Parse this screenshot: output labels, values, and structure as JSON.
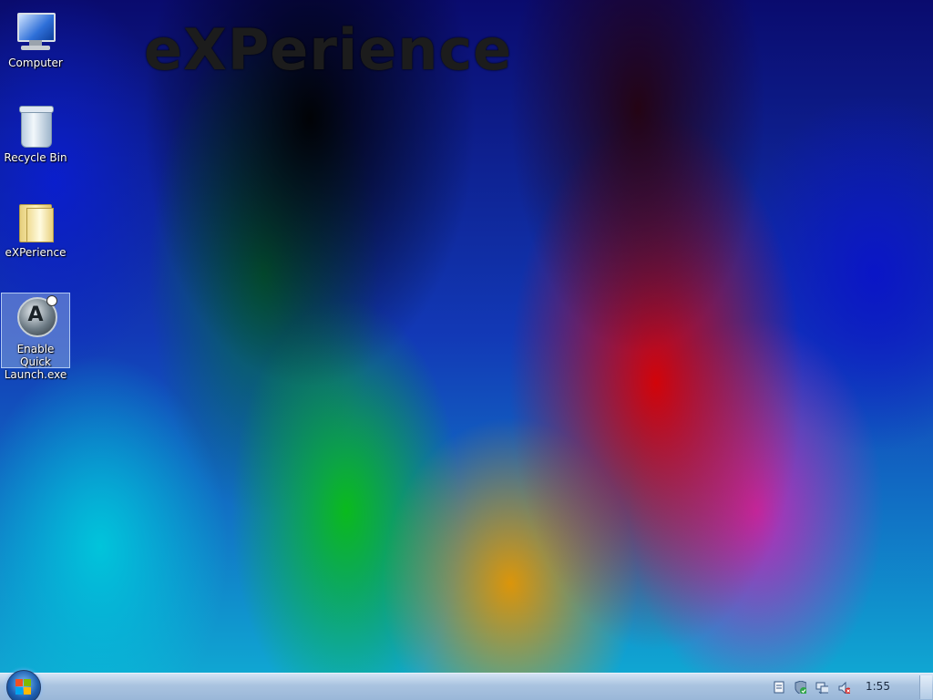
{
  "wallpaper": {
    "watermark": "eXPerience"
  },
  "desktop_icons": [
    {
      "label": "Computer",
      "icon": "computer-icon"
    },
    {
      "label": "Recycle Bin",
      "icon": "recycle-bin-icon"
    },
    {
      "label": "eXPerience",
      "icon": "folder-icon"
    },
    {
      "label": "Enable Quick Launch.exe",
      "icon": "quick-launch-app-icon",
      "selected": true
    }
  ],
  "taskbar": {
    "start_button": "start-orb-icon",
    "tray_icons": [
      "document-icon",
      "security-shield-icon",
      "network-icon",
      "volume-muted-icon"
    ],
    "clock": "1:55"
  }
}
